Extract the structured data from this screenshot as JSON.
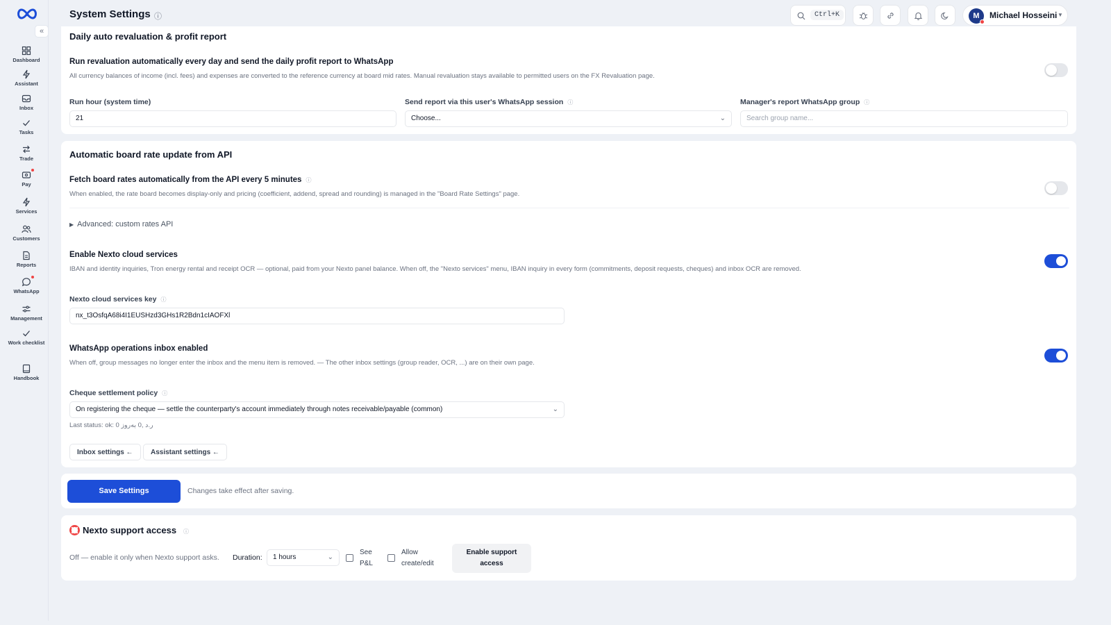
{
  "header": {
    "title": "System Settings",
    "search_shortcut": "Ctrl+K",
    "user": {
      "initial": "M",
      "name": "Michael Hosseini"
    }
  },
  "sidebar": {
    "items": [
      {
        "label": "Dashboard",
        "icon": "dashboard-icon"
      },
      {
        "label": "Assistant",
        "icon": "sparkle-icon"
      },
      {
        "label": "Inbox",
        "icon": "inbox-icon"
      },
      {
        "label": "Tasks",
        "icon": "check-icon"
      },
      {
        "label": "Trade",
        "icon": "arrows-icon"
      },
      {
        "label": "Pay",
        "icon": "wallet-icon"
      },
      {
        "label": "Services",
        "icon": "bolt-icon"
      },
      {
        "label": "Customers",
        "icon": "users-icon"
      },
      {
        "label": "Reports",
        "icon": "report-icon"
      },
      {
        "label": "WhatsApp",
        "icon": "chat-icon"
      },
      {
        "label": "Management",
        "icon": "sliders-icon"
      },
      {
        "label": "Work checklist",
        "icon": "check-icon"
      },
      {
        "label": "Handbook",
        "icon": "book-icon"
      }
    ]
  },
  "revaluation": {
    "title": "Daily auto revaluation & profit report",
    "option_title": "Run revaluation automatically every day and send the daily profit report to WhatsApp",
    "option_desc": "All currency balances of income (incl. fees) and expenses are converted to the reference currency at board mid rates. Manual revaluation stays available to permitted users on the FX Revaluation page.",
    "enabled": false,
    "run_hour_label": "Run hour (system time)",
    "run_hour_value": "21",
    "session_label": "Send report via this user's WhatsApp session",
    "session_value": "Choose...",
    "group_label": "Manager's report WhatsApp group",
    "group_placeholder": "Search group name..."
  },
  "board_rate": {
    "title": "Automatic board rate update from API",
    "fetch_title": "Fetch board rates automatically from the API every 5 minutes",
    "fetch_desc": "When enabled, the rate board becomes display-only and pricing (coefficient, addend, spread and rounding) is managed in the \"Board Rate Settings\" page.",
    "fetch_enabled": false,
    "advanced_label": "Advanced: custom rates API",
    "cloud_title": "Enable Nexto cloud services",
    "cloud_desc": "IBAN and identity inquiries, Tron energy rental and receipt OCR — optional, paid from your Nexto panel balance. When off, the \"Nexto services\" menu, IBAN inquiry in every form (commitments, deposit requests, cheques) and inbox OCR are removed.",
    "cloud_enabled": true,
    "key_label": "Nexto cloud services key",
    "key_value": "nx_t3OsfqA68i4I1EUSHzd3GHs1R2Bdn1cIAOFXl",
    "inbox_title": "WhatsApp operations inbox enabled",
    "inbox_desc": "When off, group messages no longer enter the inbox and the menu item is removed. — The other inbox settings (group reader, OCR, ...) are on their own page.",
    "inbox_enabled": true,
    "cheque_label": "Cheque settlement policy",
    "cheque_value": "On registering the cheque — settle the counterparty's account immediately through notes receivable/payable (common)",
    "last_status": "Last status: ok: 0 ر.د ,0 بەروز",
    "inbox_settings_btn": "Inbox settings ←",
    "assistant_settings_btn": "Assistant settings ←"
  },
  "save": {
    "button": "Save Settings",
    "note": "Changes take effect after saving."
  },
  "support": {
    "title": "Nexto support access",
    "desc": "Off — enable it only when Nexto support asks.",
    "duration_label": "Duration:",
    "duration_value": "1 hours",
    "see_pl_label_1": "See",
    "see_pl_label_2": "P&L",
    "allow_label_1": "Allow",
    "allow_label_2": "create/edit",
    "enable_btn_1": "Enable support",
    "enable_btn_2": "access"
  }
}
